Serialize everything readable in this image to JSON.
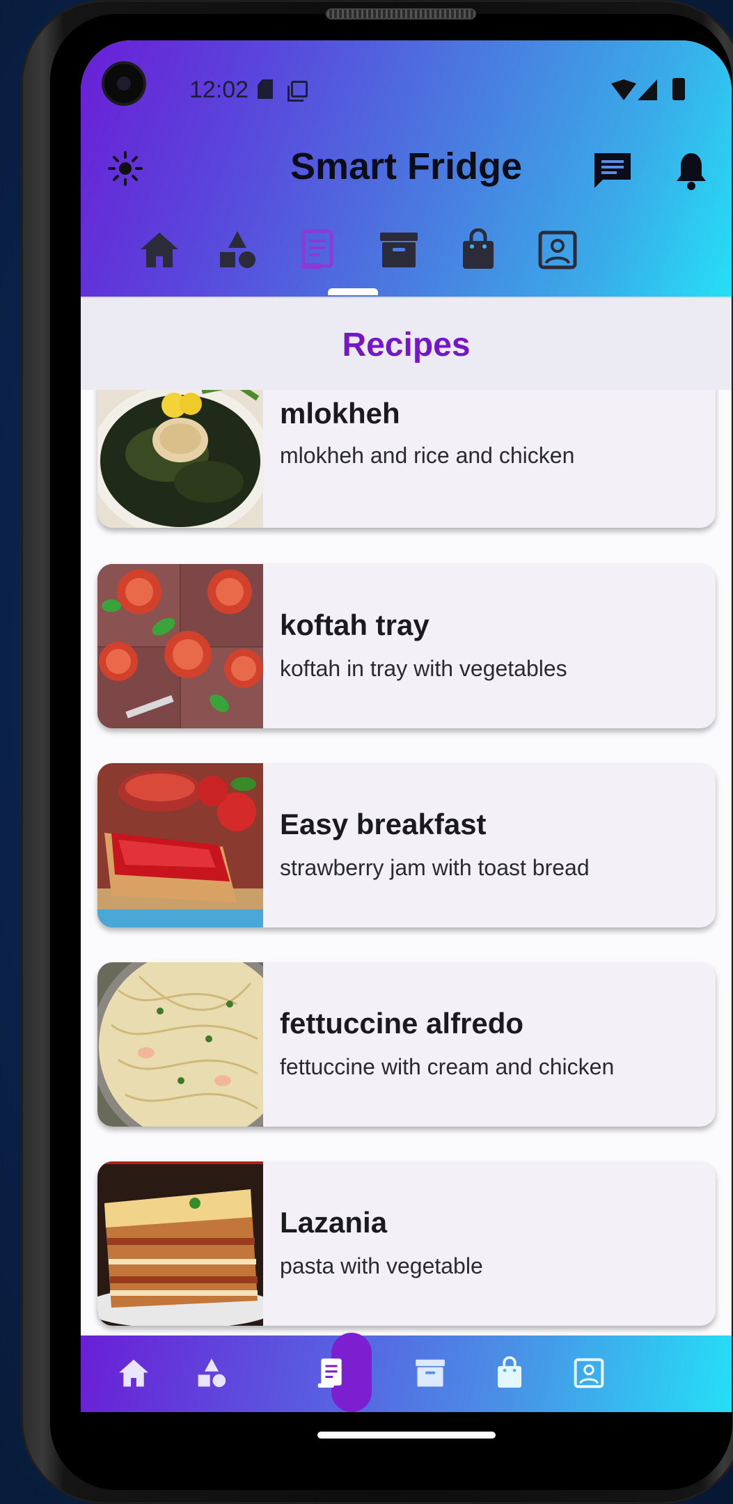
{
  "status_bar": {
    "time": "12:02"
  },
  "header": {
    "title": "Smart Fridge"
  },
  "top_tabs": [
    {
      "icon": "home-icon"
    },
    {
      "icon": "category-icon"
    },
    {
      "icon": "recipe-icon",
      "active": true
    },
    {
      "icon": "archive-icon"
    },
    {
      "icon": "shopping-bag-icon"
    },
    {
      "icon": "profile-icon"
    }
  ],
  "page": {
    "title": "Recipes"
  },
  "recipes": [
    {
      "title": "mlokheh",
      "description": "mlokheh and rice and chicken"
    },
    {
      "title": "koftah tray",
      "description": "koftah in tray with vegetables"
    },
    {
      "title": "Easy breakfast",
      "description": "strawberry jam with toast bread"
    },
    {
      "title": "fettuccine alfredo",
      "description": "fettuccine with cream and chicken"
    },
    {
      "title": "Lazania",
      "description": "pasta with vegetable"
    }
  ],
  "colors": {
    "accent": "#7417c7",
    "gradient_start": "#6a1fd6",
    "gradient_end": "#25dff6"
  }
}
